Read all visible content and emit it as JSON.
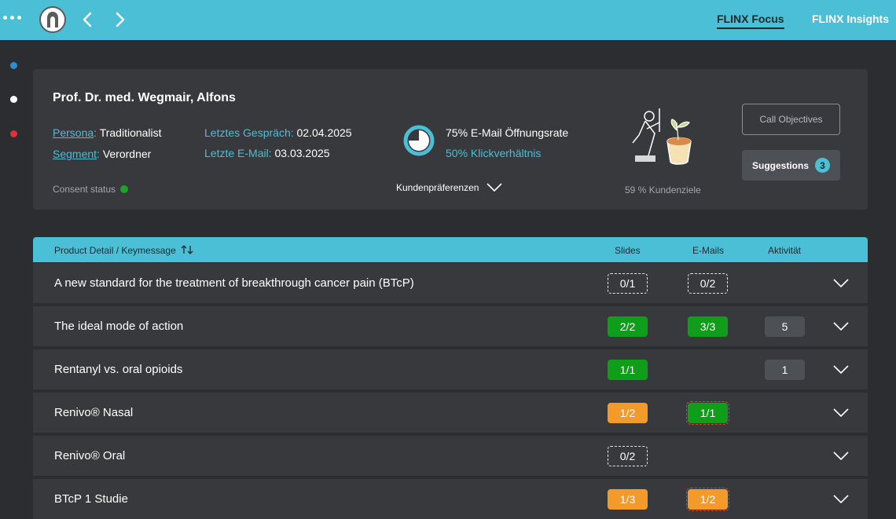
{
  "topbar": {
    "tabs": [
      {
        "label": "FLINX Focus",
        "active": true
      },
      {
        "label": "FLINX Insights",
        "active": false
      }
    ],
    "icons": [
      "more-icon",
      "logo-icon",
      "back-icon",
      "forward-icon"
    ]
  },
  "sidebar": {
    "dots": [
      {
        "color": "#2a8fd0"
      },
      {
        "color": "#ffffff"
      },
      {
        "color": "#e0303a"
      }
    ]
  },
  "profile": {
    "name": "Prof. Dr. med. Wegmair, Alfons",
    "persona_label": "Persona",
    "persona_value": "Traditionalist",
    "segment_label": "Segment",
    "segment_value": "Verordner",
    "last_call_label": "Letztes Gespräch:",
    "last_call_value": "02.04.2025",
    "last_email_label": "Letzte E-Mail:",
    "last_email_value": "03.03.2025",
    "consent_label": "Consent status",
    "consent_color": "#1aa526",
    "open_rate": "75% E-Mail Öffnungsrate",
    "open_rate_value": 0.75,
    "click_rate": "50% Klickverhältnis",
    "preferences_label": "Kundenpräferenzen",
    "goal_label": "59 % Kundenziele",
    "call_objectives_label": "Call Objectives",
    "suggestions_label": "Suggestions",
    "suggestions_count": "3"
  },
  "table": {
    "headers": {
      "product": "Product Detail / Keymessage",
      "slides": "Slides",
      "emails": "E-Mails",
      "activity": "Aktivität"
    },
    "rows": [
      {
        "title": "A new standard for the treatment of breakthrough cancer pain (BTcP)",
        "slides": "0/1",
        "slides_style": "outline",
        "emails": "0/2",
        "emails_style": "outline",
        "activity": ""
      },
      {
        "title": "The ideal mode of action",
        "slides": "2/2",
        "slides_style": "green",
        "emails": "3/3",
        "emails_style": "green",
        "activity": "5"
      },
      {
        "title": "Rentanyl vs. oral opioids",
        "slides": "1/1",
        "slides_style": "green",
        "emails": "",
        "emails_style": "",
        "activity": "1"
      },
      {
        "title": "Renivo® Nasal",
        "slides": "1/2",
        "slides_style": "orange",
        "emails": "1/1",
        "emails_style": "green red-dash",
        "activity": ""
      },
      {
        "title": "Renivo® Oral",
        "slides": "0/2",
        "slides_style": "outline",
        "emails": "",
        "emails_style": "",
        "activity": ""
      },
      {
        "title": "BTcP 1 Studie",
        "slides": "1/3",
        "slides_style": "orange",
        "emails": "1/2",
        "emails_style": "orange red-dash",
        "activity": ""
      }
    ]
  }
}
